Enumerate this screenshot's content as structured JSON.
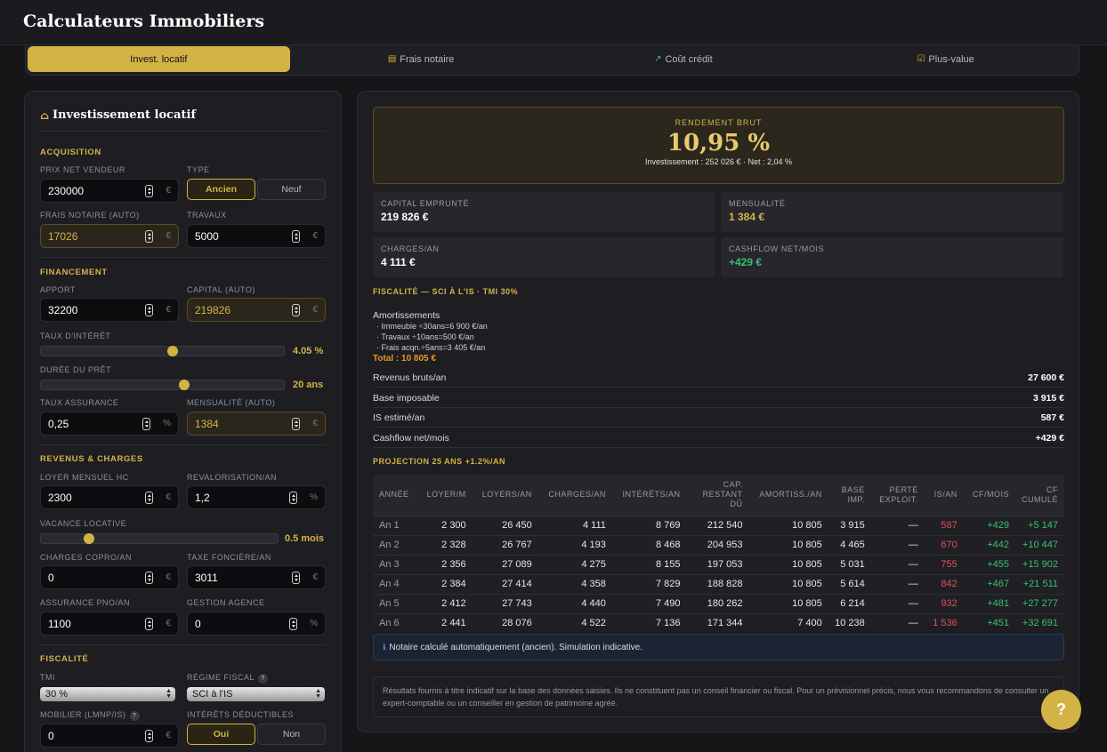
{
  "app": {
    "title": "Calculateurs Immobiliers"
  },
  "tabs": [
    {
      "label": "Invest. locatif",
      "icon": "",
      "active": true
    },
    {
      "label": "Frais notaire",
      "icon": "clipboard-icon"
    },
    {
      "label": "Coût crédit",
      "icon": "trending-up-icon"
    },
    {
      "label": "Plus-value",
      "icon": "check-square-icon"
    }
  ],
  "form": {
    "title": "Investissement locatif",
    "icon": "home-icon",
    "acquisition": {
      "section": "ACQUISITION",
      "prix_label": "PRIX NET VENDEUR",
      "prix": "230000",
      "prix_unit": "€",
      "type_label": "TYPE",
      "type_options": [
        "Ancien",
        "Neuf"
      ],
      "type_selected": "Ancien",
      "frais_label": "FRAIS NOTAIRE (AUTO)",
      "frais": "17026",
      "frais_unit": "€",
      "travaux_label": "TRAVAUX",
      "travaux": "5000",
      "travaux_unit": "€"
    },
    "financement": {
      "section": "FINANCEMENT",
      "apport_label": "APPORT",
      "apport": "32200",
      "apport_unit": "€",
      "capital_label": "CAPITAL (AUTO)",
      "capital": "219826",
      "capital_unit": "€",
      "taux_label": "TAUX D'INTÉRÊT",
      "taux": "4.05 %",
      "taux_level": 0.54,
      "duree_label": "DURÉE DU PRÊT",
      "duree": "20 ans",
      "duree_level": 0.59,
      "assurance_label": "TAUX ASSURANCE",
      "assurance": "0,25",
      "assurance_unit": "%",
      "mensualite_label": "MENSUALITÉ (AUTO)",
      "mensualite": "1384",
      "mensualite_unit": "€"
    },
    "revenus": {
      "section": "REVENUS & CHARGES",
      "loyer_label": "LOYER MENSUEL HC",
      "loyer": "2300",
      "loyer_unit": "€",
      "revalo_label": "REVALORISATION/AN",
      "revalo": "1,2",
      "revalo_unit": "%",
      "vacance_label": "VACANCE LOCATIVE",
      "vacance": "0.5 mois",
      "vacance_level": 0.2,
      "copro_label": "CHARGES COPRO/AN",
      "copro": "0",
      "copro_unit": "€",
      "fonciere_label": "TAXE FONCIÈRE/AN",
      "fonciere": "3011",
      "fonciere_unit": "€",
      "pno_label": "ASSURANCE PNO/AN",
      "pno": "1100",
      "pno_unit": "€",
      "gestion_label": "GESTION AGENCE",
      "gestion": "0",
      "gestion_unit": "%"
    },
    "fiscalite": {
      "section": "FISCALITÉ",
      "tmi_label": "TMI",
      "tmi": "30 %",
      "regime_label": "RÉGIME FISCAL",
      "regime": "SCI à l'IS",
      "mobilier_label": "MOBILIER (LMNP/IS)",
      "mobilier": "0",
      "mobilier_unit": "€",
      "interets_label": "INTÉRÊTS DÉDUCTIBLES",
      "interets_options": [
        "Oui",
        "Non"
      ],
      "interets_selected": "Oui",
      "help": "?"
    }
  },
  "results": {
    "rendement_label": "RENDEMENT BRUT",
    "rendement": "10,95 %",
    "rendement_sub": "Investissement : 252 026 € · Net : 2,04 %",
    "cards": [
      {
        "label": "CAPITAL EMPRUNTÉ",
        "value": "219 826 €"
      },
      {
        "label": "MENSUALITÉ",
        "value": "1 384 €"
      },
      {
        "label": "CHARGES/AN",
        "value": "4 111 €"
      },
      {
        "label": "CASHFLOW NET/MOIS",
        "value": "+429 €"
      }
    ],
    "fiscalite_title": "FISCALITÉ — SCI À L'IS · TMI 30%",
    "amort_title": "Amortissements",
    "amort_lines": [
      "· Immeuble ÷30ans=6 900 €/an",
      "· Travaux ÷10ans=500 €/an",
      "· Frais acqn.÷5ans=3 405 €/an"
    ],
    "amort_total": "Total : 10 805 €",
    "rows": [
      {
        "label": "Revenus bruts/an",
        "value": "27 600 €"
      },
      {
        "label": "Base imposable",
        "value": "3 915 €"
      },
      {
        "label": "IS estimé/an",
        "value": "587 €"
      },
      {
        "label": "Cashflow net/mois",
        "value": "+429 €"
      }
    ],
    "projection_title": "PROJECTION 25 ANS +1.2%/AN",
    "table_headers": [
      "ANNÉE",
      "LOYER/M",
      "LOYERS/AN",
      "CHARGES/AN",
      "INTÉRÊTS/AN",
      "CAP. RESTANT DÛ",
      "AMORTISS./AN",
      "BASE IMP.",
      "PERTE EXPLOIT.",
      "IS/AN",
      "CF/MOIS",
      "CF CUMULÉ"
    ],
    "table_rows": [
      [
        "An 1",
        "2 300",
        "26 450",
        "4 111",
        "8 769",
        "212 540",
        "10 805",
        "3 915",
        "—",
        "587",
        "+429",
        "+5 147"
      ],
      [
        "An 2",
        "2 328",
        "26 767",
        "4 193",
        "8 468",
        "204 953",
        "10 805",
        "4 465",
        "—",
        "670",
        "+442",
        "+10 447"
      ],
      [
        "An 3",
        "2 356",
        "27 089",
        "4 275",
        "8 155",
        "197 053",
        "10 805",
        "5 031",
        "—",
        "755",
        "+455",
        "+15 902"
      ],
      [
        "An 4",
        "2 384",
        "27 414",
        "4 358",
        "7 829",
        "188 828",
        "10 805",
        "5 614",
        "—",
        "842",
        "+467",
        "+21 511"
      ],
      [
        "An 5",
        "2 412",
        "27 743",
        "4 440",
        "7 490",
        "180 262",
        "10 805",
        "6 214",
        "—",
        "932",
        "+481",
        "+27 277"
      ],
      [
        "An 6",
        "2 441",
        "28 076",
        "4 522",
        "7 136",
        "171 344",
        "7 400",
        "10 238",
        "—",
        "1 536",
        "+451",
        "+32 691"
      ]
    ],
    "note": "Notaire calculé automatiquement (ancien). Simulation indicative.",
    "disclaimer": "Résultats fournis à titre indicatif sur la base des données saisies. Ils ne constituent pas un conseil financier ou fiscal. Pour un prévisionnel précis, nous vous recommandons de consulter un expert-comptable ou un conseiller en gestion de patrimoine agréé."
  },
  "fab": "?"
}
